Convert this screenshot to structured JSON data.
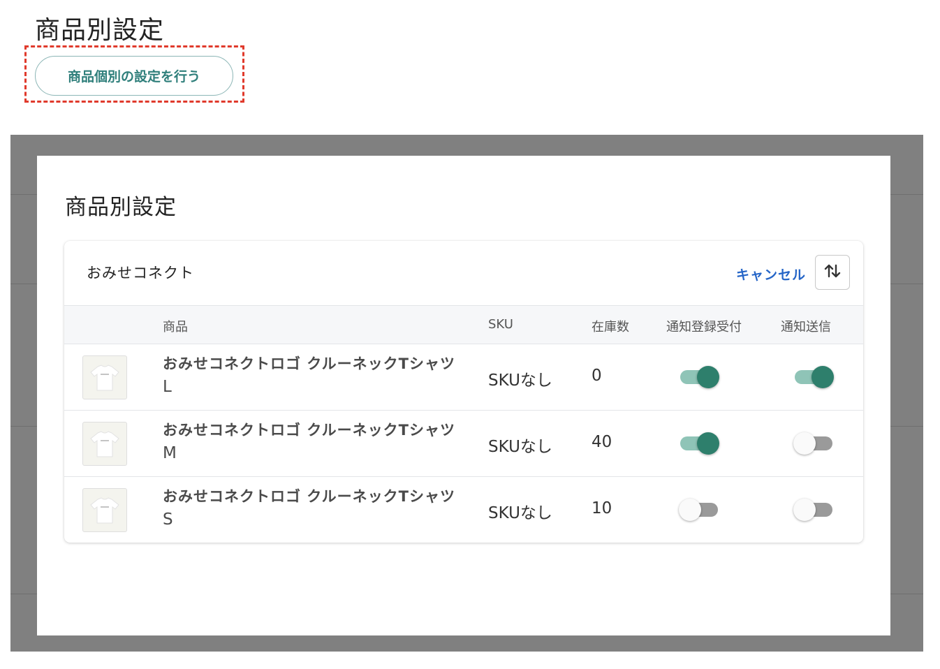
{
  "page": {
    "title": "商品別設定",
    "open_settings_button": "商品個別の設定を行う"
  },
  "modal": {
    "title": "商品別設定",
    "shop_name": "おみせコネクト",
    "cancel_label": "キャンセル",
    "sort_icon": "sort-arrows-icon",
    "columns": [
      "商品",
      "SKU",
      "在庫数",
      "通知登録受付",
      "通知送信"
    ],
    "rows": [
      {
        "name": "おみせコネクトロゴ クルーネックTシャツ",
        "size": "L",
        "sku": "SKUなし",
        "stock": "0",
        "notify_registration": true,
        "notify_send": true
      },
      {
        "name": "おみせコネクトロゴ クルーネックTシャツ",
        "size": "M",
        "sku": "SKUなし",
        "stock": "40",
        "notify_registration": true,
        "notify_send": false
      },
      {
        "name": "おみせコネクトロゴ クルーネックTシャツ",
        "size": "S",
        "sku": "SKUなし",
        "stock": "10",
        "notify_registration": false,
        "notify_send": false
      }
    ]
  },
  "colors": {
    "accent_teal": "#2e7f6c",
    "highlight_red": "#e03a2c",
    "link_blue": "#2565c7"
  }
}
